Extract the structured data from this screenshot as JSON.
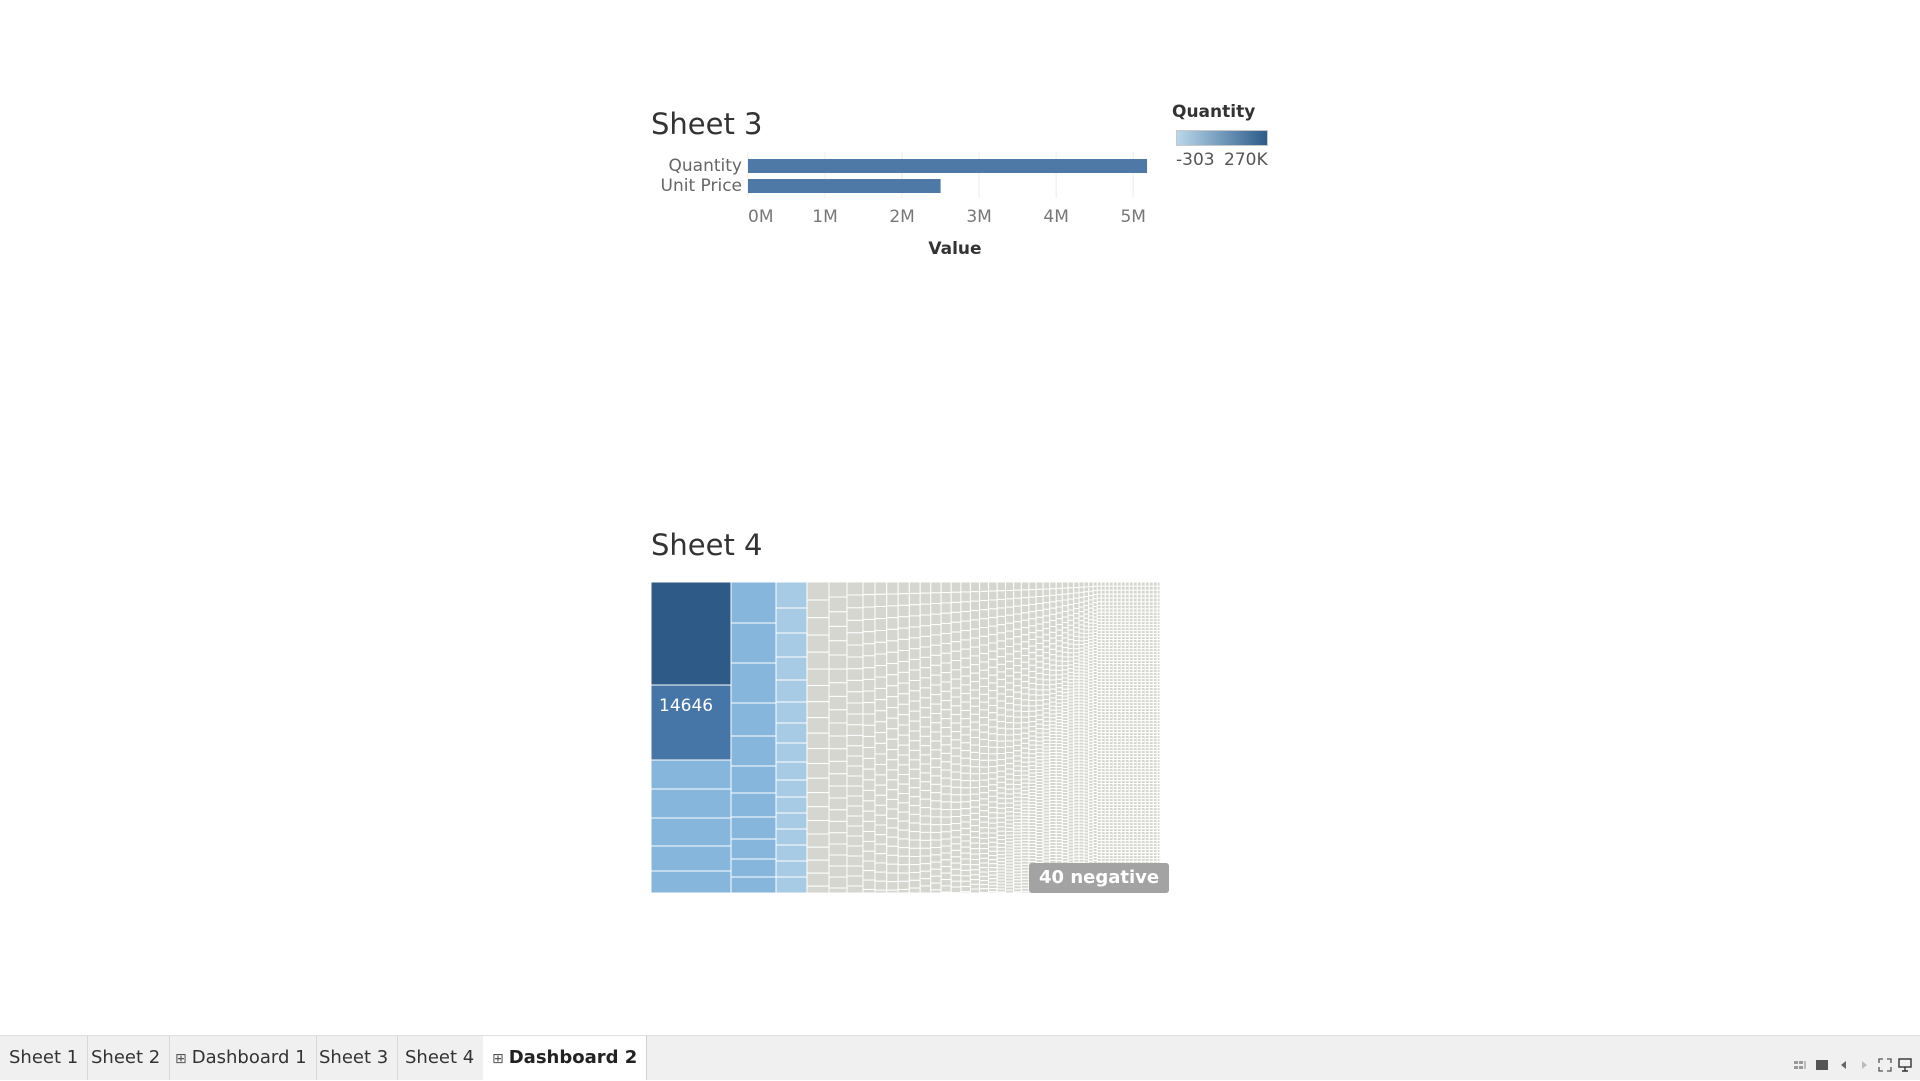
{
  "sheet3": {
    "title": "Sheet 3",
    "legend": {
      "title": "Quantity",
      "min_label": "-303",
      "max_label": "270K",
      "colors": [
        "#b9d7ea",
        "#2c5c8a"
      ]
    }
  },
  "sheet4": {
    "title": "Sheet 4",
    "mark_label": "14646",
    "negative_badge": "40 negative",
    "colors": {
      "darkest": "#2e5a87",
      "dark": "#4676a8",
      "mid": "#86b6dc",
      "light": "#a7cbe4",
      "neutral": "#d4d6cf"
    }
  },
  "chart_data": [
    {
      "type": "bar",
      "orientation": "horizontal",
      "categories": [
        "Quantity",
        "Unit Price"
      ],
      "values": [
        5180000,
        2500000
      ],
      "xlabel": "Value",
      "xlim": [
        0,
        5400000
      ],
      "x_ticks": [
        0,
        1000000,
        2000000,
        3000000,
        4000000,
        5000000
      ],
      "x_tick_labels": [
        "0M",
        "1M",
        "2M",
        "3M",
        "4M",
        "5M"
      ],
      "bar_color": "#4e79a7",
      "grid": true
    }
  ],
  "tabs": [
    {
      "label": "Sheet 1",
      "type": "sheet",
      "active": false
    },
    {
      "label": "Sheet 2",
      "type": "sheet",
      "active": false
    },
    {
      "label": "Dashboard 1",
      "type": "dashboard",
      "active": false
    },
    {
      "label": "Sheet 3",
      "type": "sheet",
      "active": false
    },
    {
      "label": "Sheet 4",
      "type": "sheet",
      "active": false
    },
    {
      "label": "Dashboard 2",
      "type": "dashboard",
      "active": true
    }
  ],
  "controls": [
    {
      "icon": "grid-view-icon"
    },
    {
      "icon": "filmstrip-view-icon"
    },
    {
      "icon": "previous-tab-icon"
    },
    {
      "icon": "next-tab-icon"
    },
    {
      "icon": "fullscreen-icon"
    },
    {
      "icon": "presentation-icon"
    }
  ]
}
